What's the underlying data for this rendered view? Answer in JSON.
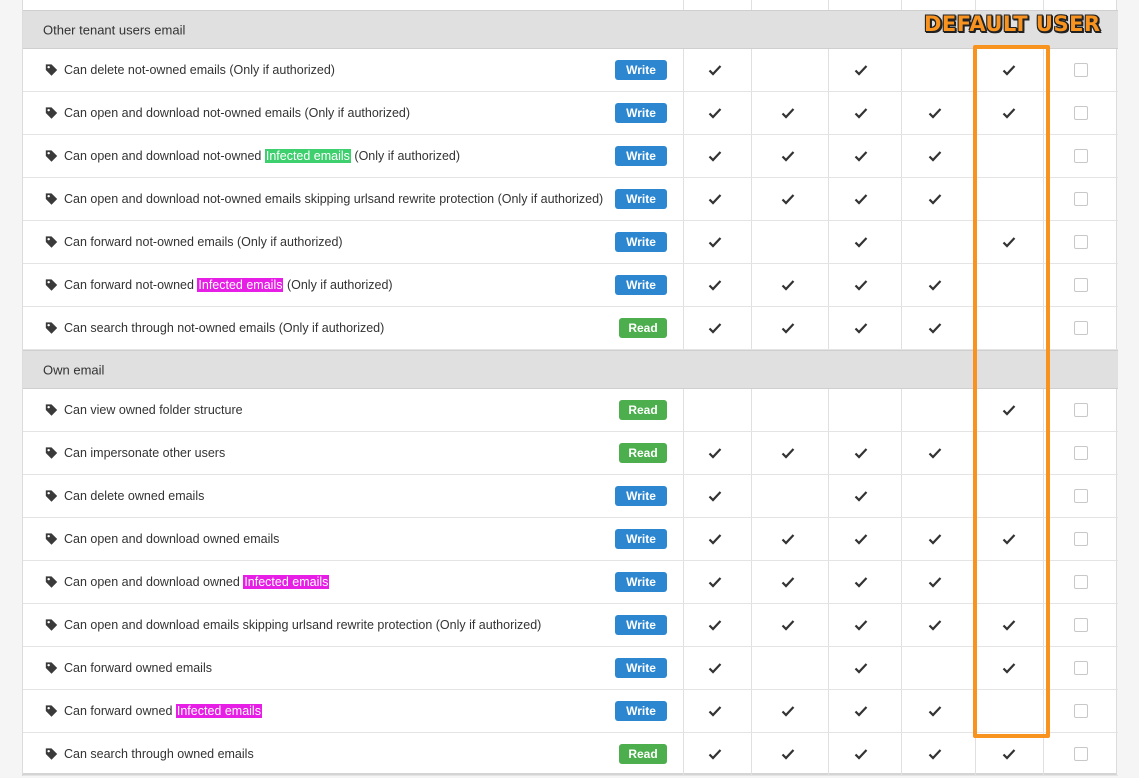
{
  "annotation": {
    "label": "DEFAULT USER",
    "color": "#f7931e"
  },
  "colors": {
    "write": "#2d87d0",
    "read": "#4cae4c",
    "green_highlight": "#3ecf6e",
    "magenta_highlight": "#e61ee6"
  },
  "columns": 6,
  "rows": [
    {
      "kind": "section",
      "title": "Other tenant users email"
    },
    {
      "kind": "perm",
      "text": [
        {
          "t": "Can delete not-owned emails (Only if authorized)"
        }
      ],
      "badge": "Write",
      "checks": [
        true,
        false,
        true,
        false,
        true
      ],
      "box": false
    },
    {
      "kind": "perm",
      "text": [
        {
          "t": "Can open and download not-owned emails (Only if authorized)"
        }
      ],
      "badge": "Write",
      "checks": [
        true,
        true,
        true,
        true,
        true
      ],
      "box": false
    },
    {
      "kind": "perm",
      "text": [
        {
          "t": "Can open and download not-owned "
        },
        {
          "t": "Infected emails",
          "hl": "green"
        },
        {
          "t": " (Only if authorized)"
        }
      ],
      "badge": "Write",
      "checks": [
        true,
        true,
        true,
        true,
        false
      ],
      "box": false
    },
    {
      "kind": "perm",
      "text": [
        {
          "t": "Can open and download not-owned emails skipping urlsand rewrite protection (Only if authorized)"
        }
      ],
      "badge": "Write",
      "checks": [
        true,
        true,
        true,
        true,
        false
      ],
      "box": false
    },
    {
      "kind": "perm",
      "text": [
        {
          "t": "Can forward not-owned emails (Only if authorized)"
        }
      ],
      "badge": "Write",
      "checks": [
        true,
        false,
        true,
        false,
        true
      ],
      "box": false
    },
    {
      "kind": "perm",
      "text": [
        {
          "t": "Can forward not-owned "
        },
        {
          "t": "Infected emails",
          "hl": "magenta"
        },
        {
          "t": " (Only if authorized)"
        }
      ],
      "badge": "Write",
      "checks": [
        true,
        true,
        true,
        true,
        false
      ],
      "box": false
    },
    {
      "kind": "perm",
      "text": [
        {
          "t": "Can search through not-owned emails (Only if authorized)"
        }
      ],
      "badge": "Read",
      "checks": [
        true,
        true,
        true,
        true,
        false
      ],
      "box": false
    },
    {
      "kind": "section",
      "title": "Own email"
    },
    {
      "kind": "perm",
      "text": [
        {
          "t": "Can view owned folder structure"
        }
      ],
      "badge": "Read",
      "checks": [
        false,
        false,
        false,
        false,
        true
      ],
      "box": false
    },
    {
      "kind": "perm",
      "text": [
        {
          "t": "Can impersonate other users"
        }
      ],
      "badge": "Read",
      "checks": [
        true,
        true,
        true,
        true,
        false
      ],
      "box": false
    },
    {
      "kind": "perm",
      "text": [
        {
          "t": "Can delete owned emails"
        }
      ],
      "badge": "Write",
      "checks": [
        true,
        false,
        true,
        false,
        false
      ],
      "box": false
    },
    {
      "kind": "perm",
      "text": [
        {
          "t": "Can open and download owned emails"
        }
      ],
      "badge": "Write",
      "checks": [
        true,
        true,
        true,
        true,
        true
      ],
      "box": false
    },
    {
      "kind": "perm",
      "text": [
        {
          "t": "Can open and download owned "
        },
        {
          "t": "Infected emails",
          "hl": "magenta"
        }
      ],
      "badge": "Write",
      "checks": [
        true,
        true,
        true,
        true,
        false
      ],
      "box": false
    },
    {
      "kind": "perm",
      "text": [
        {
          "t": "Can open and download emails skipping urlsand rewrite protection (Only if authorized)"
        }
      ],
      "badge": "Write",
      "checks": [
        true,
        true,
        true,
        true,
        true
      ],
      "box": false
    },
    {
      "kind": "perm",
      "text": [
        {
          "t": "Can forward owned emails"
        }
      ],
      "badge": "Write",
      "checks": [
        true,
        false,
        true,
        false,
        true
      ],
      "box": false
    },
    {
      "kind": "perm",
      "text": [
        {
          "t": "Can forward owned "
        },
        {
          "t": "Infected emails",
          "hl": "magenta"
        }
      ],
      "badge": "Write",
      "checks": [
        true,
        true,
        true,
        true,
        false
      ],
      "box": false
    },
    {
      "kind": "perm",
      "text": [
        {
          "t": "Can search through owned emails"
        }
      ],
      "badge": "Read",
      "checks": [
        true,
        true,
        true,
        true,
        true
      ],
      "box": false
    }
  ]
}
